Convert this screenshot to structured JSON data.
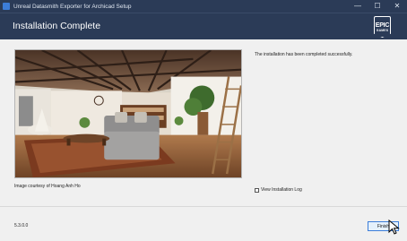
{
  "window": {
    "title": "Unreal Datasmith Exporter for Archicad Setup",
    "controls": {
      "minimize": "—",
      "maximize": "☐",
      "close": "✕"
    }
  },
  "header": {
    "title": "Installation Complete",
    "logo": {
      "line1": "EPIC",
      "line2": "GAMES"
    }
  },
  "image": {
    "credit": "Image courtesy of Hoang Anh Ho"
  },
  "message": "The installation has been completed successfully.",
  "view_log": {
    "label": "View Installation Log",
    "checked": false
  },
  "footer": {
    "version": "5.3.0.0",
    "finish_label": "Finish"
  },
  "icons": [
    "app-icon",
    "epic-games-logo",
    "checkbox",
    "mouse-cursor-icon"
  ],
  "colors": {
    "header_bg": "#2b3b57",
    "accent": "#3c7dd9",
    "body_bg": "#f0f0f0"
  }
}
